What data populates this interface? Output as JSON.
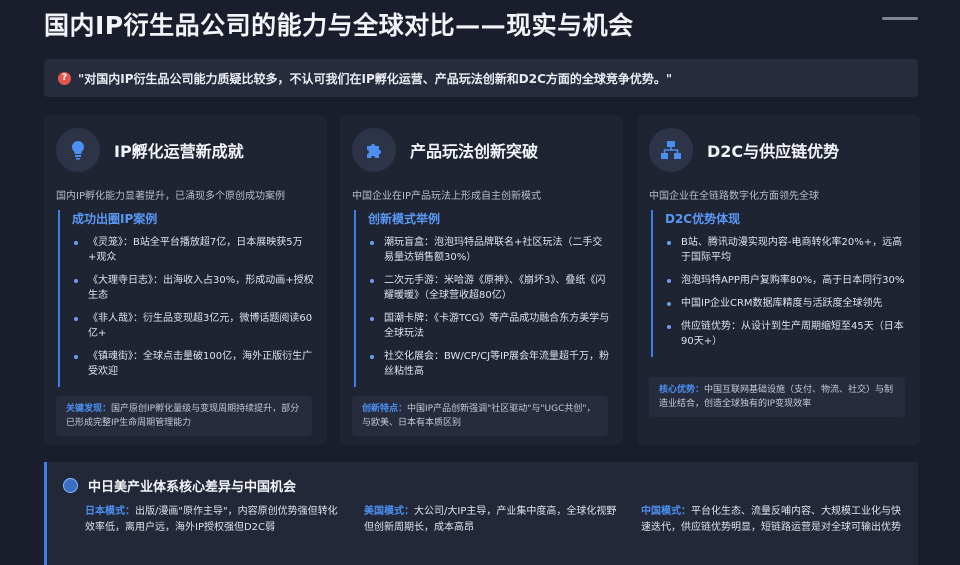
{
  "page": {
    "title": "国内IP衍生品公司的能力与全球对比——现实与机会"
  },
  "banner": {
    "icon": "question-icon",
    "text": "\"对国内IP衍生品公司能力质疑比较多，不认可我们在IP孵化运营、产品玩法创新和D2C方面的全球竞争优势。\""
  },
  "cards": [
    {
      "icon": "lightbulb-icon",
      "title": "IP孵化运营新成就",
      "subtitle": "国内IP孵化能力显著提升，已涌现多个原创成功案例",
      "list_head": "成功出圈IP案例",
      "items": [
        "《灵笼》：B站全平台播放超7亿，日本展映获5万+观众",
        "《大理寺日志》：出海收入占30%，形成动画+授权生态",
        "《非人哉》：衍生品变现超3亿元，微博话题阅读60亿+",
        "《镇魂街》：全球点击量破100亿，海外正版衍生广受欢迎"
      ],
      "note_label": "关键发现：",
      "note_text": "国产原创IP孵化量级与变现周期持续提升，部分已形成完整IP生命周期管理能力"
    },
    {
      "icon": "puzzle-icon",
      "title": "产品玩法创新突破",
      "subtitle": "中国企业在IP产品玩法上形成自主创新模式",
      "list_head": "创新模式举例",
      "items": [
        "潮玩盲盒：泡泡玛特品牌联名+社区玩法（二手交易量达销售额30%）",
        "二次元手游：米哈游《原神》、《崩坏3》、叠纸《闪耀暖暖》（全球营收超80亿）",
        "国潮卡牌：《卡游TCG》等产品成功融合东方美学与全球玩法",
        "社交化展会：BW/CP/CJ等IP展会年流量超千万，粉丝粘性高"
      ],
      "note_label": "创新特点：",
      "note_text": "中国IP产品创新强调\"社区驱动\"与\"UGC共创\"，与欧美、日本有本质区别"
    },
    {
      "icon": "network-icon",
      "title": "D2C与供应链优势",
      "subtitle": "中国企业在全链路数字化方面领先全球",
      "list_head": "D2C优势体现",
      "items": [
        "B站、腾讯动漫实现内容-电商转化率20%+，远高于国际平均",
        "泡泡玛特APP用户复购率80%，高于日本同行30%",
        "中国IP企业CRM数据库精度与活跃度全球领先",
        "供应链优势：从设计到生产周期缩短至45天（日本90天+）"
      ],
      "note_label": "核心优势：",
      "note_text": "中国互联网基础设施（支付、物流、社交）与制造业结合，创造全球独有的IP变现效率"
    }
  ],
  "bottom": {
    "icon": "globe-icon",
    "title": "中日美产业体系核心差异与中国机会",
    "columns": [
      {
        "label": "日本模式：",
        "text": "出版/漫画\"原作主导\"，内容原创优势强但转化效率低，离用户远，海外IP授权强但D2C弱"
      },
      {
        "label": "美国模式：",
        "text": "大公司/大IP主导，产业集中度高，全球化视野但创新周期长，成本高昂"
      },
      {
        "label": "中国模式：",
        "text": "平台化生态、流量反哺内容、大规模工业化与快速迭代，供应链优势明显，短链路运营是对全球可输出优势"
      }
    ]
  },
  "colors": {
    "background": "#1a1e2c",
    "accent": "#4d8ff0",
    "card": "#1f2433"
  }
}
